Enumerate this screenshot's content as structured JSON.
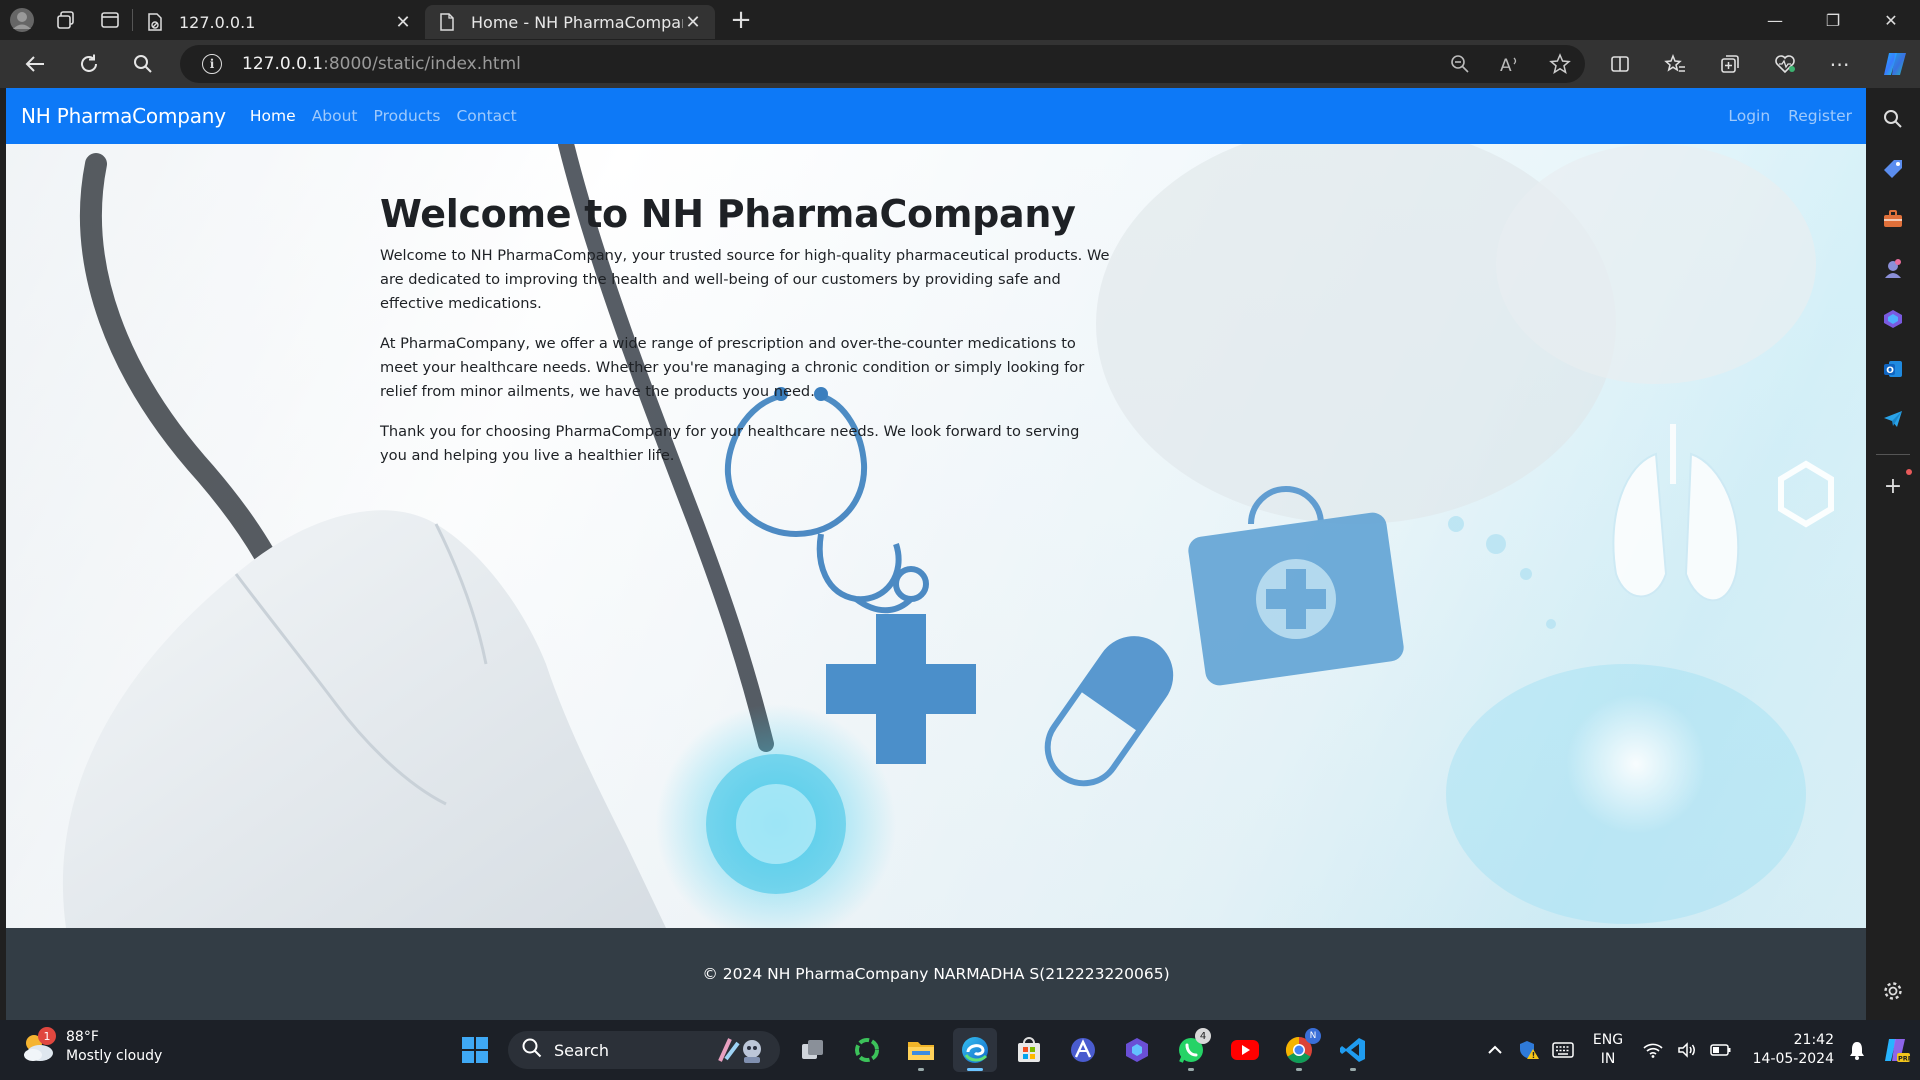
{
  "browser": {
    "tabs": [
      {
        "title": "127.0.0.1",
        "active": false
      },
      {
        "title": "Home - NH PharmaCompany",
        "active": true
      }
    ],
    "url_host": "127.0.0.1",
    "url_path": ":8000/static/index.html",
    "new_tab_symbol": "+"
  },
  "site": {
    "brand": "NH PharmaCompany",
    "nav": [
      {
        "label": "Home",
        "active": true
      },
      {
        "label": "About",
        "active": false
      },
      {
        "label": "Products",
        "active": false
      },
      {
        "label": "Contact",
        "active": false
      }
    ],
    "auth": [
      {
        "label": "Login"
      },
      {
        "label": "Register"
      }
    ],
    "hero": {
      "heading": "Welcome to NH PharmaCompany",
      "paragraphs": [
        "Welcome to NH PharmaCompany, your trusted source for high-quality pharmaceutical products. We are dedicated to improving the health and well-being of our customers by providing safe and effective medications.",
        "At PharmaCompany, we offer a wide range of prescription and over-the-counter medications to meet your healthcare needs. Whether you're managing a chronic condition or simply looking for relief from minor ailments, we have the products you need.",
        "Thank you for choosing PharmaCompany for your healthcare needs. We look forward to serving you and helping you live a healthier life."
      ]
    },
    "footer": "© 2024 NH PharmaCompany NARMADHA S(212223220065)"
  },
  "taskbar": {
    "weather_temp": "88°F",
    "weather_desc": "Mostly cloudy",
    "weather_badge": "1",
    "search_label": "Search",
    "whatsapp_badge": "4",
    "chrome_badge": "N",
    "lang_line1": "ENG",
    "lang_line2": "IN",
    "time": "21:42",
    "date": "14-05-2024"
  },
  "colors": {
    "navbar": "#0d79f7",
    "footer": "#333d45",
    "chrome_dark": "#202020",
    "toolbar": "#333333",
    "taskbar": "#1c2027"
  }
}
